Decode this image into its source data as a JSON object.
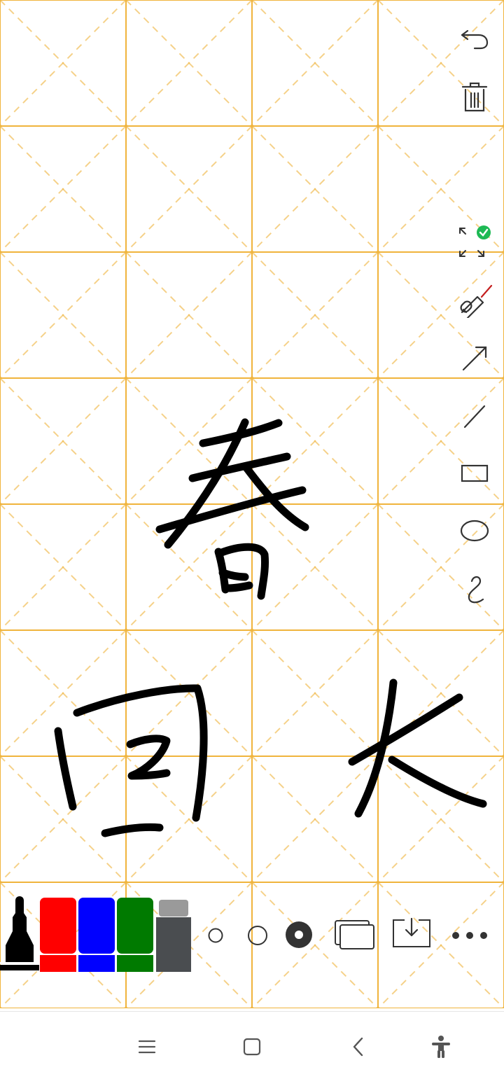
{
  "app": {
    "background_color": "#ffffff",
    "grid_color": "#f0b43c",
    "ink_color": "#000000"
  },
  "grid": {
    "columns": 4,
    "rows": 8,
    "style": "米字格 (rice-character grid with dashed diagonals)"
  },
  "handwriting": {
    "characters": [
      "春",
      "回",
      "大"
    ]
  },
  "side_toolbar": {
    "items": [
      {
        "name": "undo-icon"
      },
      {
        "name": "trash-icon"
      },
      {
        "name": "fullscreen-icon",
        "badge_color": "#1db954"
      },
      {
        "name": "laser-pointer-icon"
      },
      {
        "name": "arrow-tool-icon"
      },
      {
        "name": "line-tool-icon"
      },
      {
        "name": "rectangle-tool-icon"
      },
      {
        "name": "ellipse-tool-icon"
      },
      {
        "name": "freehand-tool-icon"
      }
    ]
  },
  "bottom_toolbar": {
    "pens": [
      {
        "name": "black",
        "color": "#000000",
        "selected": true
      },
      {
        "name": "red",
        "color": "#ff0000"
      },
      {
        "name": "blue",
        "color": "#0000ff"
      },
      {
        "name": "green",
        "color": "#007a00"
      },
      {
        "name": "eraser",
        "color": "#4a4d50"
      }
    ],
    "stroke_sizes": [
      "small",
      "medium",
      "large"
    ],
    "selected_stroke_size": "large",
    "actions": [
      "pages-icon",
      "save-icon",
      "more-icon"
    ]
  },
  "nav_bar": {
    "buttons": [
      "menu-icon",
      "home-icon",
      "back-icon",
      "accessibility-icon"
    ]
  }
}
